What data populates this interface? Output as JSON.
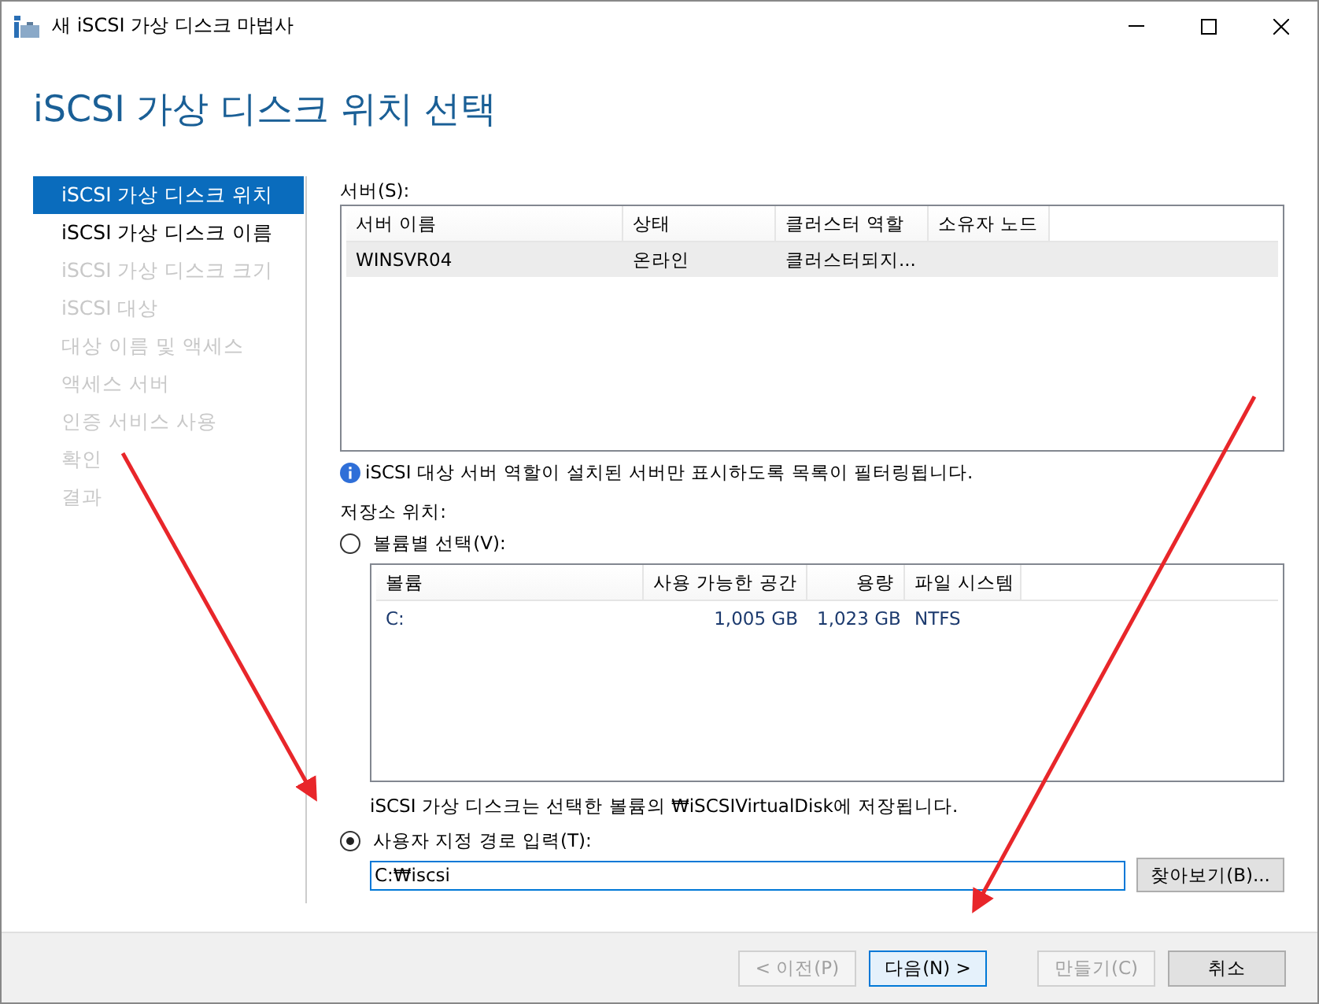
{
  "window": {
    "title": "새 iSCSI 가상 디스크 마법사"
  },
  "heading": "iSCSI 가상 디스크 위치 선택",
  "steps": [
    {
      "label": "iSCSI 가상 디스크 위치",
      "selected": true,
      "disabled": false
    },
    {
      "label": "iSCSI 가상 디스크 이름",
      "selected": false,
      "disabled": false
    },
    {
      "label": "iSCSI 가상 디스크 크기",
      "selected": false,
      "disabled": true
    },
    {
      "label": "iSCSI 대상",
      "selected": false,
      "disabled": true
    },
    {
      "label": "대상 이름 및 액세스",
      "selected": false,
      "disabled": true
    },
    {
      "label": "액세스 서버",
      "selected": false,
      "disabled": true
    },
    {
      "label": "인증 서비스 사용",
      "selected": false,
      "disabled": true
    },
    {
      "label": "확인",
      "selected": false,
      "disabled": true
    },
    {
      "label": "결과",
      "selected": false,
      "disabled": true
    }
  ],
  "servers": {
    "label": "서버(S):",
    "columns": [
      "서버 이름",
      "상태",
      "클러스터 역할",
      "소유자 노드"
    ],
    "rows": [
      {
        "cells": [
          "WINSVR04",
          "온라인",
          "클러스터되지...",
          ""
        ],
        "selected": true
      }
    ],
    "info": "iSCSI 대상 서버 역할이 설치된 서버만 표시하도록 목록이 필터링됩니다."
  },
  "storage": {
    "label": "저장소 위치:",
    "by_volume": {
      "label": "볼륨별 선택(V):",
      "selected": false
    },
    "volumes": {
      "columns": [
        "볼륨",
        "사용 가능한 공간",
        "용량",
        "파일 시스템"
      ],
      "rows": [
        {
          "cells": [
            "C:",
            "1,005 GB",
            "1,023 GB",
            "NTFS"
          ]
        }
      ]
    },
    "note": "iSCSI 가상 디스크는 선택한 볼륨의 ₩iSCSIVirtualDisk에 저장됩니다.",
    "custom_path": {
      "label": "사용자 지정 경로 입력(T):",
      "selected": true,
      "value": "C:₩iscsi"
    },
    "browse": "찾아보기(B)..."
  },
  "buttons": [
    {
      "label": "< 이전(P)",
      "disabled": true,
      "default": false
    },
    {
      "label": "다음(N) >",
      "disabled": false,
      "default": true
    },
    {
      "label": "만들기(C)",
      "disabled": true,
      "default": false
    },
    {
      "label": "취소",
      "disabled": false,
      "default": false
    }
  ]
}
